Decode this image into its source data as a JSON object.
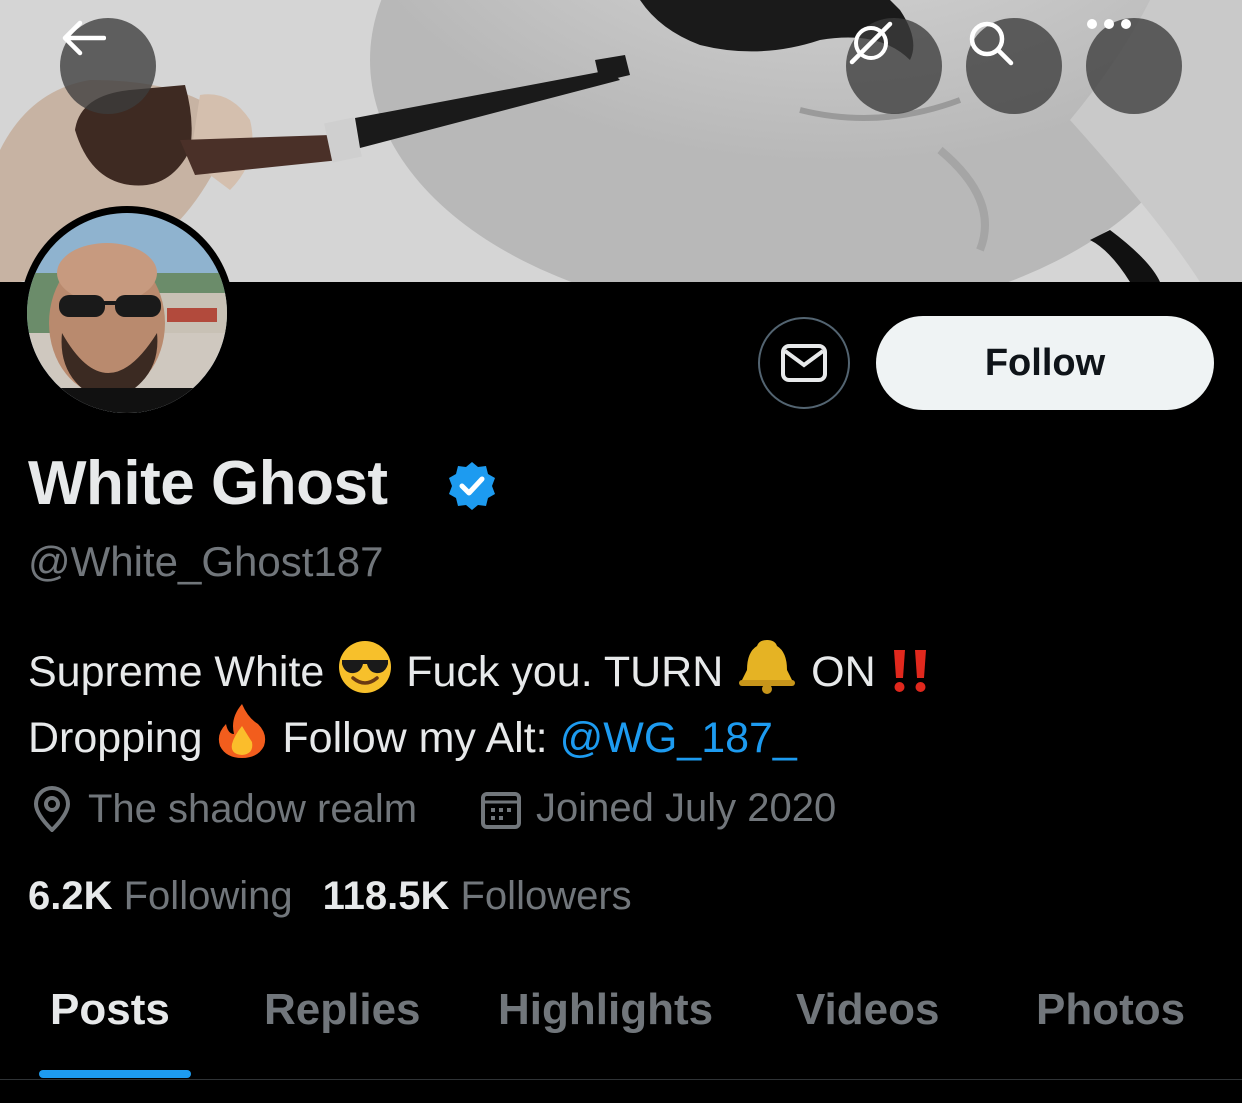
{
  "colors": {
    "accent": "#1d9bf0",
    "text": "#e7e9ea",
    "muted": "#71767b",
    "background": "#000000"
  },
  "topbar": {
    "back_icon": "arrow-left-icon",
    "grok_icon": "grok-icon",
    "search_icon": "search-icon",
    "more_icon": "more-horizontal-icon"
  },
  "profile": {
    "display_name": "White Ghost",
    "verified": true,
    "handle": "@White_Ghost187",
    "follow_label": "Follow",
    "message_icon": "mail-icon",
    "bio": {
      "line1_a": "Supreme White",
      "line1_b": "Fuck you. TURN",
      "line1_c": "ON",
      "line2_a": "Dropping",
      "line2_b": "Follow my Alt:",
      "mention": "@WG_187_"
    },
    "location": "The shadow realm",
    "joined": "Joined July 2020",
    "following_count": "6.2K",
    "following_label": "Following",
    "followers_count": "118.5K",
    "followers_label": "Followers"
  },
  "tabs": [
    {
      "label": "Posts",
      "active": true
    },
    {
      "label": "Replies"
    },
    {
      "label": "Highlights"
    },
    {
      "label": "Videos"
    },
    {
      "label": "Photos"
    }
  ]
}
